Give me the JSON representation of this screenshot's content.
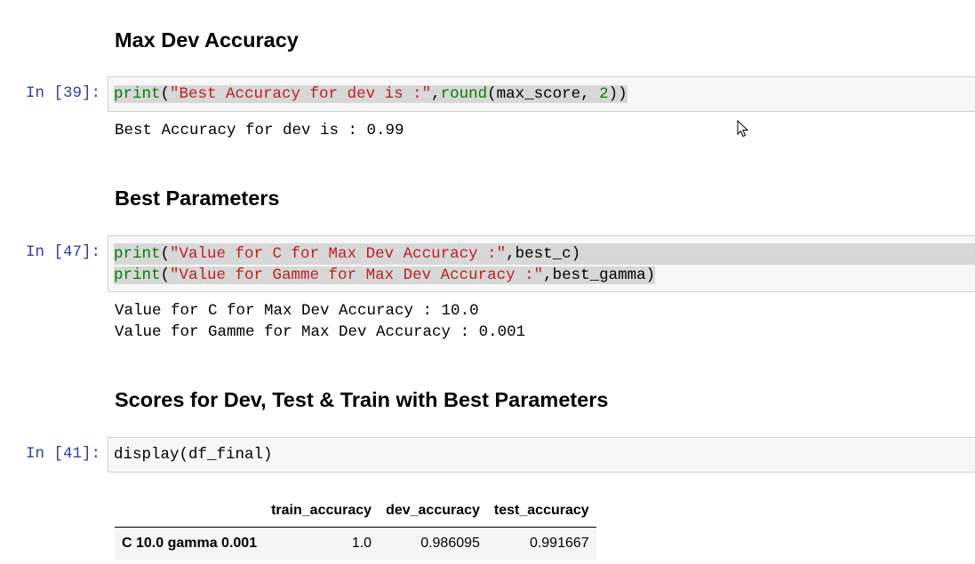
{
  "sections": [
    {
      "heading": "Max Dev Accuracy"
    },
    {
      "heading": "Best Parameters"
    },
    {
      "heading": "Scores for Dev, Test & Train with Best Parameters"
    }
  ],
  "cells": [
    {
      "prompt": "In [39]:",
      "code": [
        [
          {
            "t": "print",
            "c": "kw"
          },
          {
            "t": "(",
            "c": ""
          },
          {
            "t": "\"Best Accuracy for dev is :\"",
            "c": "str"
          },
          {
            "t": ",",
            "c": ""
          },
          {
            "t": "round",
            "c": "kw"
          },
          {
            "t": "(max_score, ",
            "c": ""
          },
          {
            "t": "2",
            "c": "num"
          },
          {
            "t": "))",
            "c": ""
          }
        ]
      ],
      "output": [
        "Best Accuracy for dev is : 0.99"
      ]
    },
    {
      "prompt": "In [47]:",
      "code": [
        [
          {
            "t": "print",
            "c": "kw"
          },
          {
            "t": "(",
            "c": ""
          },
          {
            "t": "\"Value for C for Max Dev Accuracy :\"",
            "c": "str"
          },
          {
            "t": ",best_c)",
            "c": ""
          }
        ],
        [
          {
            "t": "print",
            "c": "kw"
          },
          {
            "t": "(",
            "c": ""
          },
          {
            "t": "\"Value for Gamme for Max Dev Accuracy :\"",
            "c": "str"
          },
          {
            "t": ",best_gamma)",
            "c": ""
          }
        ]
      ],
      "output": [
        "Value for C for Max Dev Accuracy : 10.0",
        "Value for Gamme for Max Dev Accuracy : 0.001"
      ]
    },
    {
      "prompt": "In [41]:",
      "code": [
        [
          {
            "t": "display(df_final)",
            "c": ""
          }
        ]
      ],
      "output": []
    }
  ],
  "dataframe": {
    "columns": [
      "",
      "train_accuracy",
      "dev_accuracy",
      "test_accuracy"
    ],
    "rows": [
      {
        "index": "C 10.0 gamma 0.001",
        "values": [
          "1.0",
          "0.986095",
          "0.991667"
        ]
      }
    ]
  },
  "cursor_icon": "mouse-pointer-icon"
}
